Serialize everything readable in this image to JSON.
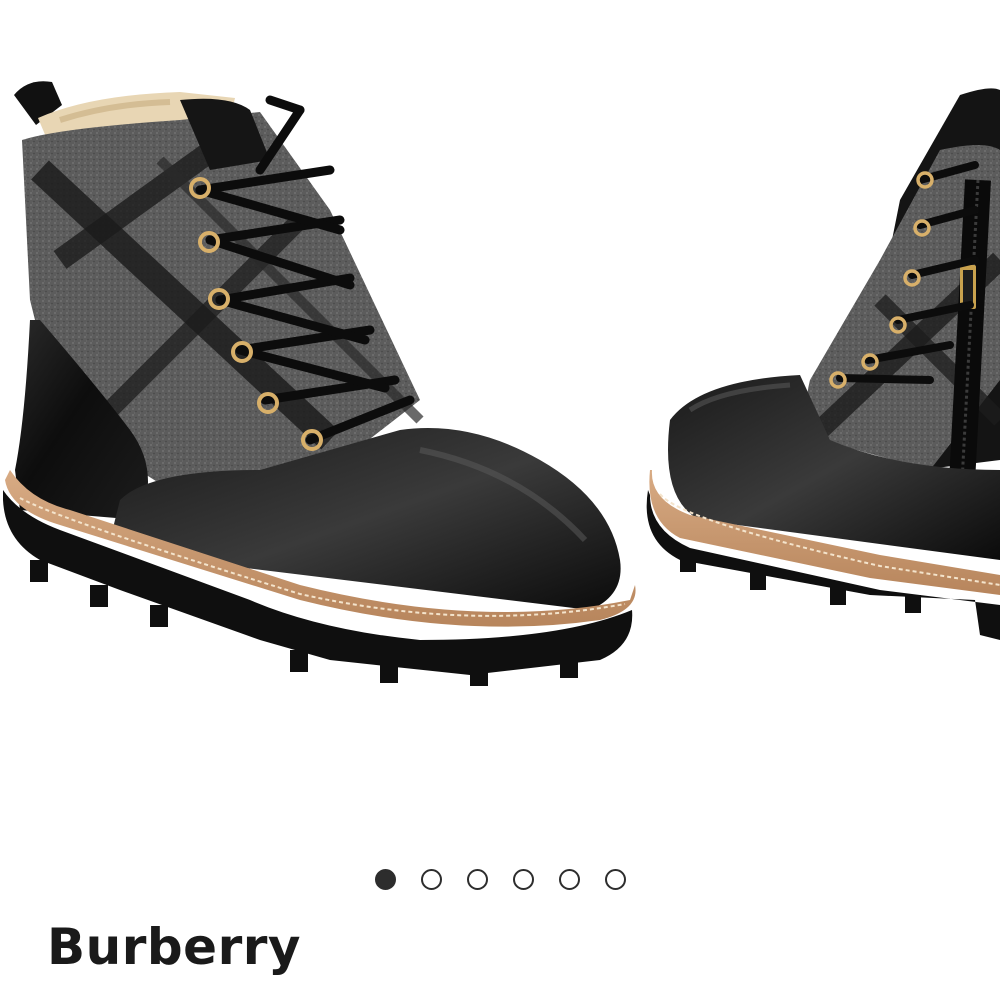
{
  "product": {
    "brand": "Burberry",
    "image_description_icon": "boot-photo"
  },
  "carousel": {
    "slide_count": 6,
    "active_index": 0,
    "colors": {
      "dot": "#2d2d2d",
      "leather": "#141414",
      "wool": "#5a5a5a",
      "sole_welt": "#c89a72"
    }
  }
}
